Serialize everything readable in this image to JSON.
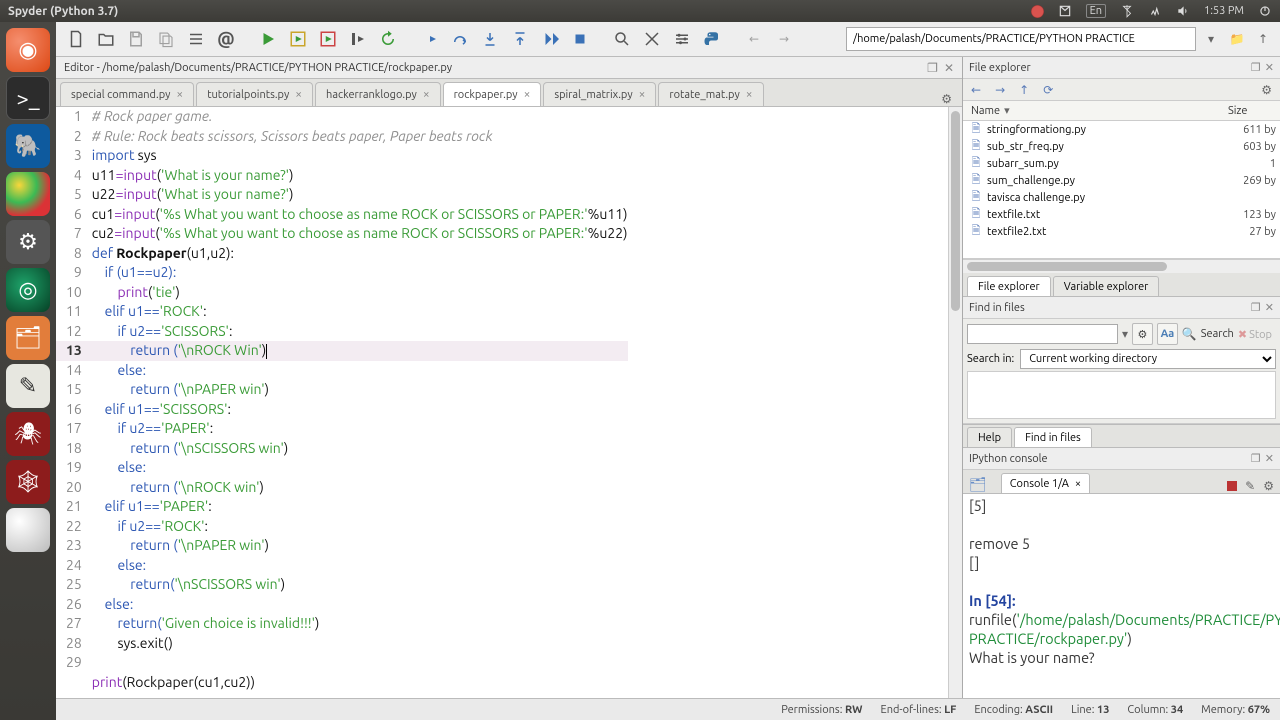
{
  "window_title": "Spyder (Python 3.7)",
  "time": "1:53 PM",
  "lang_indicator": "En",
  "path_input": "/home/palash/Documents/PRACTICE/PYTHON PRACTICE",
  "editor_path": "Editor - /home/palash/Documents/PRACTICE/PYTHON PRACTICE/rockpaper.py",
  "tabs": [
    {
      "label": "special command.py"
    },
    {
      "label": "tutorialpoints.py"
    },
    {
      "label": "hackerranklogo.py"
    },
    {
      "label": "rockpaper.py",
      "active": true
    },
    {
      "label": "spiral_matrix.py"
    },
    {
      "label": "rotate_mat.py"
    }
  ],
  "file_explorer": {
    "title": "File explorer",
    "col_name": "Name",
    "col_size": "Size",
    "files": [
      {
        "name": "stringformationg.py",
        "size": "611 by"
      },
      {
        "name": "sub_str_freq.py",
        "size": "603 by"
      },
      {
        "name": "subarr_sum.py",
        "size": "1"
      },
      {
        "name": "sum_challenge.py",
        "size": "269 by"
      },
      {
        "name": "tavisca challenge.py",
        "size": ""
      },
      {
        "name": "textfile.txt",
        "size": "123 by"
      },
      {
        "name": "textfile2.txt",
        "size": "27 by"
      }
    ],
    "subtab1": "File explorer",
    "subtab2": "Variable explorer"
  },
  "find_in_files": {
    "title": "Find in files",
    "search_label": "Search",
    "stop_label": "Stop",
    "search_in_label": "Search in:",
    "search_in_value": "Current working directory",
    "help_tab": "Help",
    "find_tab": "Find in files"
  },
  "console": {
    "title": "IPython console",
    "tab": "Console 1/A",
    "line1": "[5]",
    "line2": "remove 5",
    "line3": "[]",
    "in_prompt": "In [54]: ",
    "run1": "runfile(",
    "run_path": "'/home/palash/Documents/PRACTICE/PYTHON PRACTICE/rockpaper.py'",
    "run_end": ")",
    "prompt_q": "What is your name?"
  },
  "statusbar": {
    "perm_label": "Permissions:",
    "perm": "RW",
    "eol_label": "End-of-lines:",
    "eol": "LF",
    "enc_label": "Encoding:",
    "enc": "ASCII",
    "line_label": "Line:",
    "line": "13",
    "col_label": "Column:",
    "col": "34",
    "mem_label": "Memory:",
    "mem": "67%"
  },
  "code": {
    "l1": "# Rock paper game.",
    "l2": "# Rule: Rock beats scissors, Scissors beats paper, Paper beats rock",
    "l3a": "import",
    "l3b": " sys",
    "l4a": "u11",
    "l4b": "=",
    "l4c": "input",
    "l4d": "(",
    "l4e": "'What is your name?'",
    "l4f": ")",
    "l5a": "u22",
    "l5e": "'What is your name?'",
    "l6a": "cu1",
    "l6e": "'%s What you want to choose as name ROCK or SCISSORS or PAPER:'",
    "l6f": "%u11)",
    "l7a": "cu2",
    "l7f": "%u22)",
    "l8a": "def ",
    "l8b": "Rockpaper",
    "l8c": "(u1,u2):",
    "l9": "    if (u1==u2):",
    "l10a": "        ",
    "l10b": "print",
    "l10c": "(",
    "l10d": "'tie'",
    "l10e": ")",
    "l11a": "    elif u1==",
    "l11b": "'ROCK'",
    "l11c": ":",
    "l12a": "        if u2==",
    "l12b": "'SCISSORS'",
    "l12c": ":",
    "l13a": "            return (",
    "l13b": "'\\nROCK Win'",
    "l13c": ")",
    "l14": "        else:",
    "l15a": "            return (",
    "l15b": "'\\nPAPER win'",
    "l15c": ")",
    "l16a": "    elif u1==",
    "l16b": "'SCISSORS'",
    "l16c": ":",
    "l17a": "        if u2==",
    "l17b": "'PAPER'",
    "l17c": ":",
    "l18a": "            return (",
    "l18b": "'\\nSCISSORS win'",
    "l18c": ")",
    "l19": "        else:",
    "l20a": "            return (",
    "l20b": "'\\nROCK win'",
    "l20c": ")",
    "l21a": "    elif u1==",
    "l21b": "'PAPER'",
    "l21c": ":",
    "l22a": "        if u2==",
    "l22b": "'ROCK'",
    "l22c": ":",
    "l23a": "            return (",
    "l23b": "'\\nPAPER win'",
    "l23c": ")",
    "l24": "        else:",
    "l25a": "            return(",
    "l25b": "'\\nSCISSORS win'",
    "l25c": ")",
    "l26": "    else:",
    "l27a": "        return(",
    "l27b": "'Given choice is invalid!!!'",
    "l27c": ")",
    "l28": "        sys.exit()",
    "l30a": "print",
    "l30b": "(Rockpaper(cu1,cu2))"
  }
}
